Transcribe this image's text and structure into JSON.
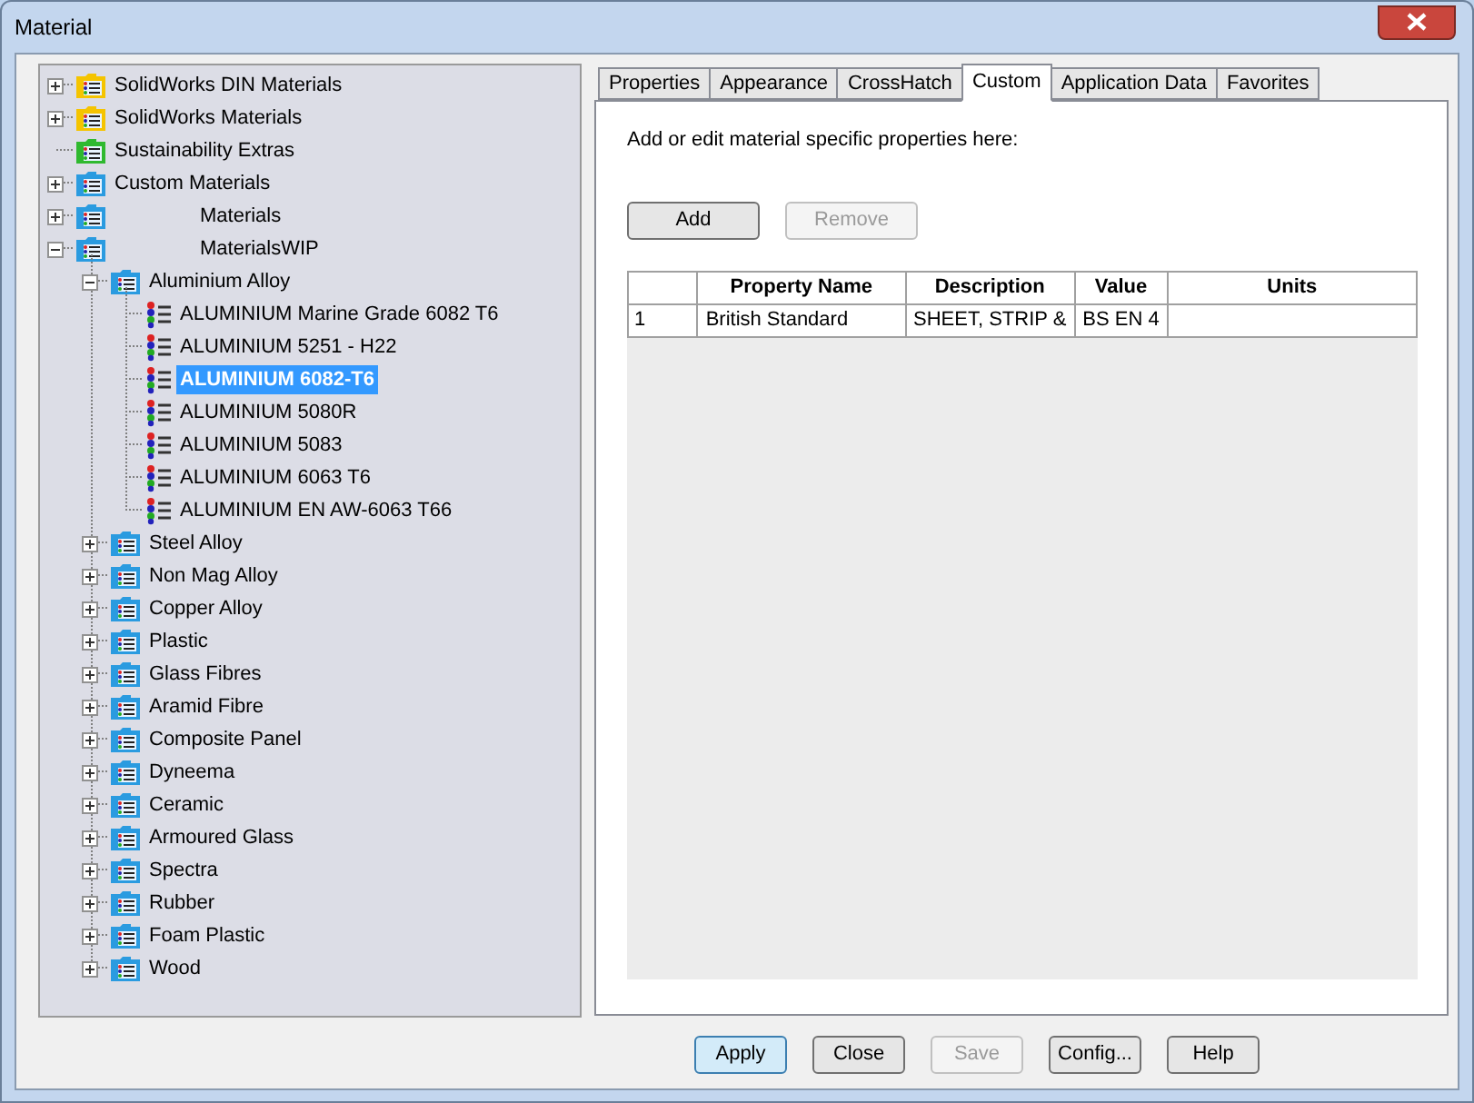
{
  "window": {
    "title": "Material"
  },
  "tree": [
    {
      "label": "SolidWorks DIN Materials",
      "kind": "folder",
      "color": "#f5c400",
      "expanded": false,
      "selected": false
    },
    {
      "label": "SolidWorks Materials",
      "kind": "folder",
      "color": "#f5c400",
      "expanded": false,
      "selected": false
    },
    {
      "label": "Sustainability Extras",
      "kind": "folder",
      "color": "#2fb92f",
      "selected": false
    },
    {
      "label": "Custom Materials",
      "kind": "folder",
      "color": "#2a9be0",
      "expanded": false,
      "selected": false
    },
    {
      "label": "Materials",
      "kind": "folder",
      "color": "#2a9be0",
      "expanded": false,
      "selected": false,
      "label_offset": true
    },
    {
      "label": "MaterialsWIP",
      "kind": "folder",
      "color": "#2a9be0",
      "expanded": true,
      "selected": false,
      "label_offset": true,
      "children": [
        {
          "label": "Aluminium Alloy",
          "kind": "folder",
          "color": "#2a9be0",
          "expanded": true,
          "selected": false,
          "children": [
            {
              "label": "ALUMINIUM Marine Grade 6082 T6",
              "kind": "material",
              "selected": false
            },
            {
              "label": "ALUMINIUM 5251 - H22",
              "kind": "material",
              "selected": false
            },
            {
              "label": "ALUMINIUM 6082-T6",
              "kind": "material",
              "selected": true
            },
            {
              "label": "ALUMINIUM 5080R",
              "kind": "material",
              "selected": false
            },
            {
              "label": "ALUMINIUM 5083",
              "kind": "material",
              "selected": false
            },
            {
              "label": "ALUMINIUM 6063 T6",
              "kind": "material",
              "selected": false
            },
            {
              "label": "ALUMINIUM EN AW-6063 T66",
              "kind": "material",
              "selected": false
            }
          ]
        },
        {
          "label": "Steel Alloy",
          "kind": "folder",
          "color": "#2a9be0",
          "expanded": false,
          "selected": false
        },
        {
          "label": "Non Mag Alloy",
          "kind": "folder",
          "color": "#2a9be0",
          "expanded": false,
          "selected": false
        },
        {
          "label": "Copper Alloy",
          "kind": "folder",
          "color": "#2a9be0",
          "expanded": false,
          "selected": false
        },
        {
          "label": "Plastic",
          "kind": "folder",
          "color": "#2a9be0",
          "expanded": false,
          "selected": false
        },
        {
          "label": "Glass Fibres",
          "kind": "folder",
          "color": "#2a9be0",
          "expanded": false,
          "selected": false
        },
        {
          "label": "Aramid Fibre",
          "kind": "folder",
          "color": "#2a9be0",
          "expanded": false,
          "selected": false
        },
        {
          "label": "Composite Panel",
          "kind": "folder",
          "color": "#2a9be0",
          "expanded": false,
          "selected": false
        },
        {
          "label": "Dyneema",
          "kind": "folder",
          "color": "#2a9be0",
          "expanded": false,
          "selected": false
        },
        {
          "label": "Ceramic",
          "kind": "folder",
          "color": "#2a9be0",
          "expanded": false,
          "selected": false
        },
        {
          "label": "Armoured Glass",
          "kind": "folder",
          "color": "#2a9be0",
          "expanded": false,
          "selected": false
        },
        {
          "label": "Spectra",
          "kind": "folder",
          "color": "#2a9be0",
          "expanded": false,
          "selected": false
        },
        {
          "label": "Rubber",
          "kind": "folder",
          "color": "#2a9be0",
          "expanded": false,
          "selected": false
        },
        {
          "label": "Foam Plastic",
          "kind": "folder",
          "color": "#2a9be0",
          "expanded": false,
          "selected": false
        },
        {
          "label": "Wood",
          "kind": "folder",
          "color": "#2a9be0",
          "expanded": false,
          "selected": false
        }
      ]
    }
  ],
  "tabs": [
    {
      "label": "Properties",
      "selected": false
    },
    {
      "label": "Appearance",
      "selected": false
    },
    {
      "label": "CrossHatch",
      "selected": false
    },
    {
      "label": "Custom",
      "selected": true
    },
    {
      "label": "Application Data",
      "selected": false
    },
    {
      "label": "Favorites",
      "selected": false
    }
  ],
  "custom": {
    "instruction": "Add or edit material specific properties here:",
    "buttons": [
      {
        "label": "Add",
        "disabled": false
      },
      {
        "label": "Remove",
        "disabled": true
      }
    ],
    "table": {
      "columns": [
        "Property Name",
        "Description",
        "Value",
        "Units"
      ],
      "rows": [
        {
          "index": "1",
          "cells": [
            "British Standard",
            "SHEET, STRIP &",
            "BS EN 4",
            ""
          ]
        }
      ]
    }
  },
  "footer_buttons": [
    {
      "label": "Apply",
      "disabled": false,
      "focused": true
    },
    {
      "label": "Close",
      "disabled": false,
      "focused": false
    },
    {
      "label": "Save",
      "disabled": true,
      "focused": false
    },
    {
      "label": "Config...",
      "disabled": false,
      "focused": false
    },
    {
      "label": "Help",
      "disabled": false,
      "focused": false
    }
  ]
}
